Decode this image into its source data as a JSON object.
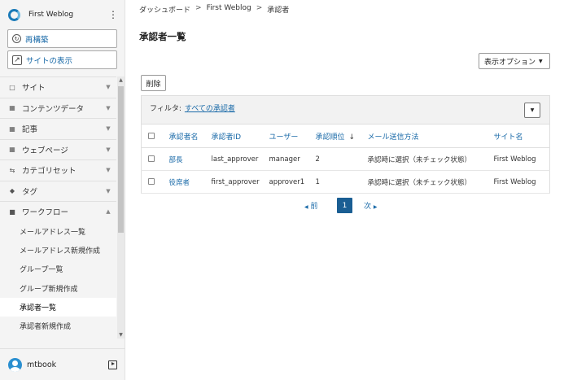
{
  "sidebar": {
    "site_name": "First Weblog",
    "rebuild_label": "再構築",
    "view_site_label": "サイトの表示",
    "menu": [
      {
        "icon": "□",
        "label": "サイト"
      },
      {
        "icon": "▦",
        "label": "コンテンツデータ"
      },
      {
        "icon": "▦",
        "label": "記事"
      },
      {
        "icon": "▦",
        "label": "ウェブページ"
      },
      {
        "icon": "⇆",
        "label": "カテゴリセット"
      },
      {
        "icon": "◆",
        "label": "タグ"
      },
      {
        "icon": "■",
        "label": "ワークフロー"
      }
    ],
    "submenu": [
      {
        "label": "メールアドレス一覧"
      },
      {
        "label": "メールアドレス新規作成"
      },
      {
        "label": "グループ一覧"
      },
      {
        "label": "グループ新規作成"
      },
      {
        "label": "承認者一覧"
      },
      {
        "label": "承認者新規作成"
      }
    ],
    "user_name": "mtbook"
  },
  "breadcrumb": {
    "items": [
      "ダッシュボード",
      "First Weblog",
      "承認者"
    ],
    "sep": ">"
  },
  "page": {
    "title": "承認者一覧",
    "display_options": "表示オプション",
    "delete_label": "削除",
    "filter_label": "フィルタ:",
    "filter_value": "すべての承認者"
  },
  "table": {
    "headers": {
      "name": "承認者名",
      "id": "承認者ID",
      "user": "ユーザー",
      "order": "承認順位",
      "mail": "メール送信方法",
      "site": "サイト名"
    },
    "rows": [
      {
        "name": "部長",
        "id": "last_approver",
        "user": "manager",
        "order": "2",
        "mail": "承認時に選択（未チェック状態）",
        "site": "First Weblog"
      },
      {
        "name": "役席者",
        "id": "first_approver",
        "user": "approver1",
        "order": "1",
        "mail": "承認時に選択（未チェック状態）",
        "site": "First Weblog"
      }
    ]
  },
  "pager": {
    "prev": "前",
    "current": "1",
    "next": "次"
  }
}
